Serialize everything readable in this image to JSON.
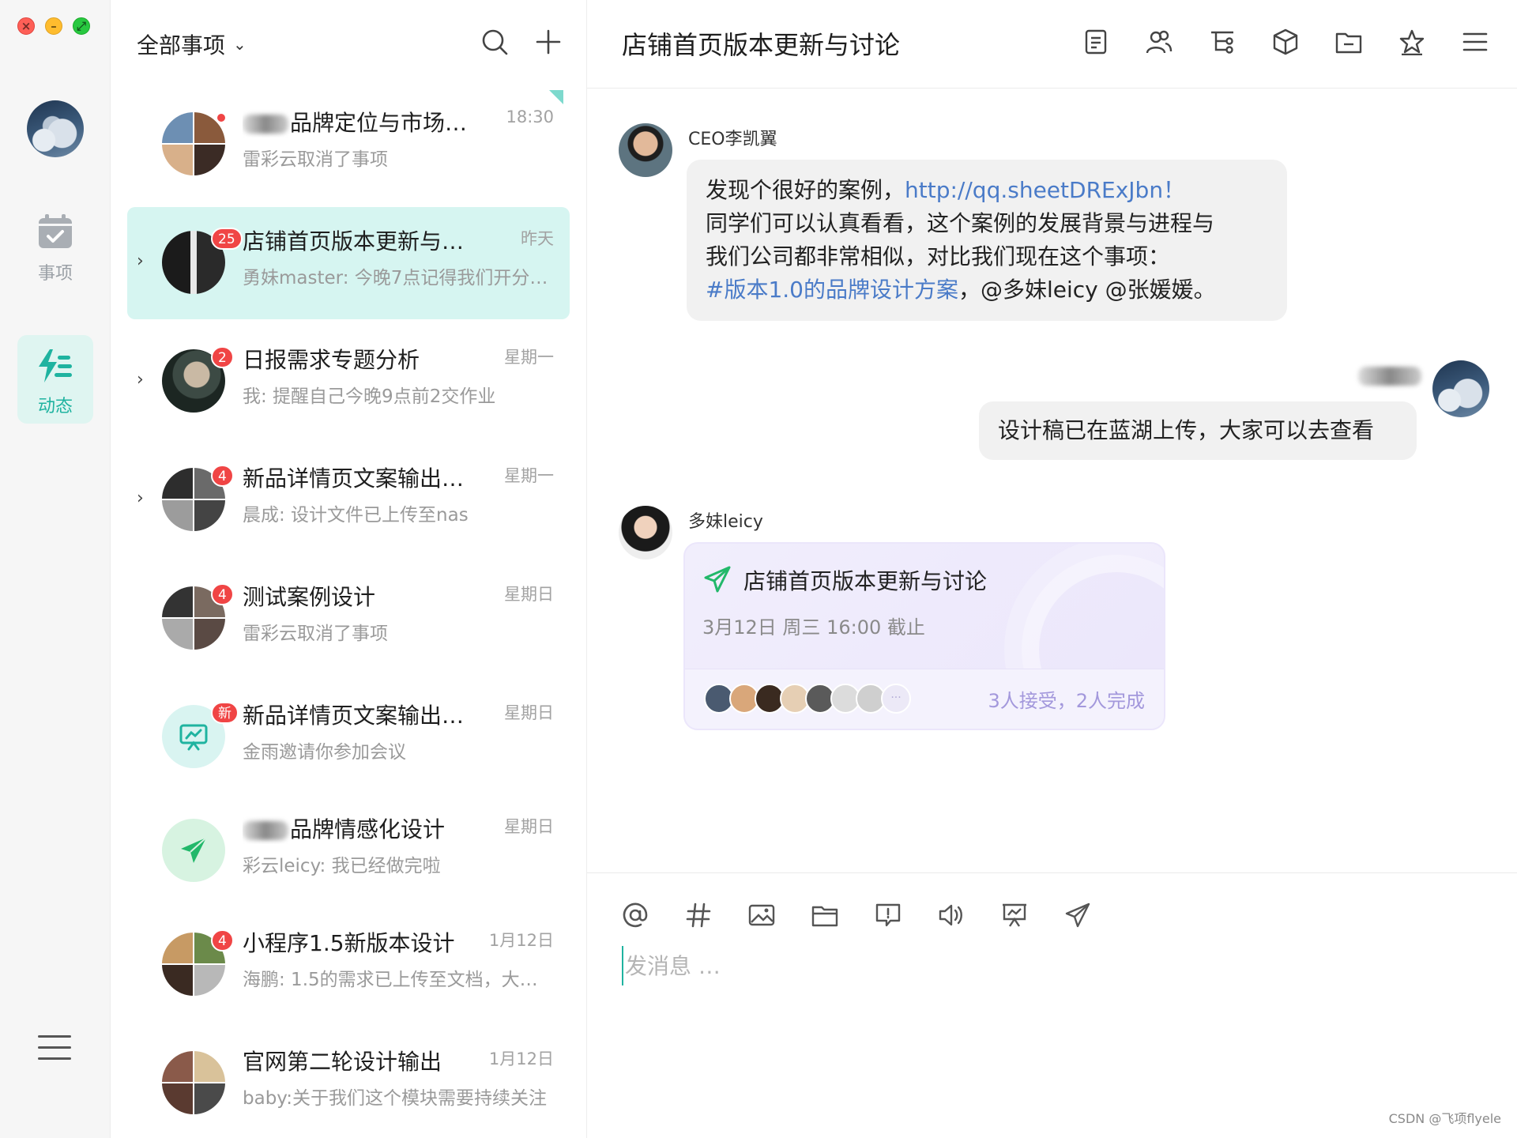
{
  "rail": {
    "events_label": "事项",
    "dynamic_label": "动态"
  },
  "list": {
    "filter_label": "全部事项",
    "items": [
      {
        "title": "品牌定位与市场推出",
        "time": "18:30",
        "sub": "雷彩云取消了事项",
        "badge": ""
      },
      {
        "title": "店铺首页版本更新与…",
        "time": "昨天",
        "sub": "勇妹master: 今晚7点记得我们开分…",
        "badge": "25"
      },
      {
        "title": "日报需求专题分析",
        "time": "星期一",
        "sub": "我: 提醒自己今晚9点前2交作业",
        "badge": "2"
      },
      {
        "title": "新品详情页文案输出…",
        "time": "星期一",
        "sub": "晨成: 设计文件已上传至nas",
        "badge": "4"
      },
      {
        "title": "测试案例设计",
        "time": "星期日",
        "sub": "雷彩云取消了事项",
        "badge": "4"
      },
      {
        "title": "新品详情页文案输出…",
        "time": "星期日",
        "sub": "金雨邀请你参加会议",
        "badge": "新"
      },
      {
        "title": "品牌情感化设计",
        "time": "星期日",
        "sub": "彩云leicy: 我已经做完啦",
        "badge": ""
      },
      {
        "title": "小程序1.5新版本设计",
        "time": "1月12日",
        "sub": "海鹏: 1.5的需求已上传至文档，大…",
        "badge": "4"
      },
      {
        "title": "官网第二轮设计输出",
        "time": "1月12日",
        "sub": "baby:关于我们这个模块需要持续关注",
        "badge": ""
      }
    ]
  },
  "chat": {
    "title": "店铺首页版本更新与讨论",
    "msg1": {
      "sender": "CEO李凯翼",
      "line1_text": "发现个很好的案例，",
      "line1_link": "http://qq.sheetDRExJbn！",
      "line2": "同学们可以认真看看，这个案例的发展背景与进程与",
      "line3": "我们公司都非常相似，对比我们现在这个事项：",
      "line4_tag": "#版本1.0的品牌设计方案",
      "line4_rest": "，@多妹leicy @张媛媛。"
    },
    "msg2": {
      "text": "设计稿已在蓝湖上传，大家可以去查看"
    },
    "msg3": {
      "sender": "多妹leicy",
      "task_title": "店铺首页版本更新与讨论",
      "task_due": "3月12日 周三 16:00 截止",
      "task_stat": "3人接受，2人完成",
      "more": "···"
    },
    "composer_placeholder": "发消息 …"
  },
  "watermark": "CSDN @飞项flyele",
  "colors": {
    "accent": "#1fb3a0",
    "active_bg": "#d6f5f1",
    "badge": "#f04545",
    "link": "#4a7bc8",
    "task_bg": "#efebfc"
  }
}
